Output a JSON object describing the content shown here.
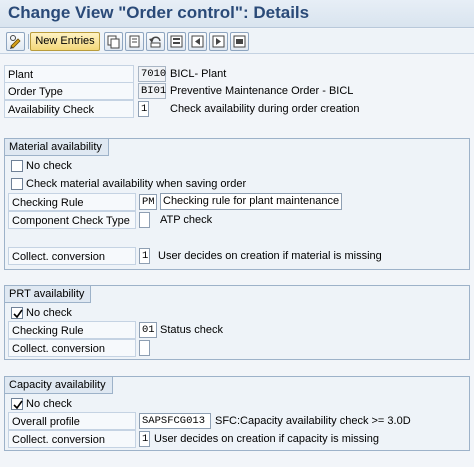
{
  "window": {
    "title": "Change View \"Order control\": Details"
  },
  "toolbar": {
    "new_entries": "New Entries",
    "icons": [
      "change-display-icon",
      "copy-icon",
      "delete-icon",
      "undo-icon",
      "select-all-icon",
      "previous-entry-icon",
      "next-entry-icon",
      "other-entry-icon"
    ]
  },
  "header": {
    "plant": {
      "label": "Plant",
      "value": "7010",
      "description": "BICL- Plant"
    },
    "order_type": {
      "label": "Order Type",
      "value": "BI01",
      "description": "Preventive Maintenance Order - BICL"
    },
    "availability_check": {
      "label": "Availability Check",
      "value": "1",
      "description": "Check availability during order creation"
    }
  },
  "material": {
    "title": "Material availability",
    "no_check": {
      "label": "No check",
      "checked": false
    },
    "check_on_save": {
      "label": "Check material availability when saving order",
      "checked": false
    },
    "checking_rule": {
      "label": "Checking Rule",
      "value": "PM",
      "description": "Checking rule for plant maintenance"
    },
    "component_check_type": {
      "label": "Component Check Type",
      "value": "",
      "description": "ATP check"
    },
    "collect_conversion": {
      "label": "Collect. conversion",
      "value": "1",
      "description": "User decides on creation if material is missing"
    }
  },
  "prt": {
    "title": "PRT availability",
    "no_check": {
      "label": "No check",
      "checked": true
    },
    "checking_rule": {
      "label": "Checking Rule",
      "value": "01",
      "description": "Status check"
    },
    "collect_conversion": {
      "label": "Collect. conversion",
      "value": ""
    }
  },
  "capacity": {
    "title": "Capacity availability",
    "no_check": {
      "label": "No check",
      "checked": true
    },
    "overall_profile": {
      "label": "Overall profile",
      "value": "SAPSFCG013",
      "description": "SFC:Capacity availability check >= 3.0D"
    },
    "collect_conversion": {
      "label": "Collect. conversion",
      "value": "1",
      "description": "User decides on creation if capacity is missing"
    }
  },
  "colors": {
    "title": "#2a4a78",
    "group_border": "#9db2c9",
    "button_yellow": "#f3d87a"
  }
}
